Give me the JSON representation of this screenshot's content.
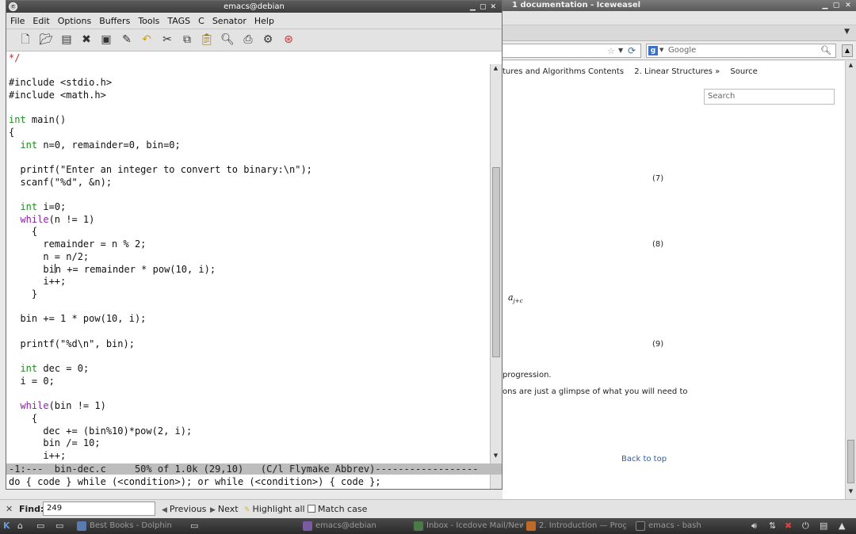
{
  "browser": {
    "title": "1 documentation - Iceweasel",
    "search_engine": "Google",
    "doc_nav": [
      "tures and Algorithms Contents",
      "2. Linear Structures »",
      "Source"
    ],
    "search_placeholder": "Search",
    "equation_numbers": [
      "(7)",
      "(8)",
      "(9)"
    ],
    "math_fragment_base": "a",
    "math_fragment_sub": "j+c",
    "text_line_1": "progression.",
    "text_line_2": "ons are just a glimpse of what you will need to",
    "back_to_top": "Back to top"
  },
  "emacs": {
    "title": "emacs@debian",
    "menu": [
      "File",
      "Edit",
      "Options",
      "Buffers",
      "Tools",
      "TAGS",
      "C",
      "Senator",
      "Help"
    ],
    "toolbar_icons": [
      "new-file-icon",
      "open-folder-icon",
      "save-icon",
      "close-icon",
      "save-as-icon",
      "edit-icon",
      "undo-icon",
      "cut-icon",
      "copy-icon",
      "paste-icon",
      "search-icon",
      "print-icon",
      "preferences-icon",
      "help-icon"
    ],
    "header_line": "*/",
    "modeline": "-1:---  bin-dec.c     50% of 1.0k (29,10)   (C/l Flymake Abbrev)------------------",
    "minibuffer": "do { code } while (<condition>); or while (<condition>) { code };"
  },
  "findbar": {
    "label": "Find:",
    "value": "249",
    "previous": "Previous",
    "next": "Next",
    "highlight_all": "Highlight all",
    "match_case": "Match case"
  },
  "taskbar": {
    "tasks": [
      {
        "label": "Best Books - Dolphin",
        "color": "#5a7bb0"
      },
      {
        "label": "emacs@debian",
        "color": "#7a5aa0"
      },
      {
        "label": "Inbox - Icedove Mail/News",
        "color": "#4a7a4a"
      },
      {
        "label": "2. Introduction — Prog",
        "color": "#c06a2a"
      },
      {
        "label": "emacs - bash",
        "color": "#333333"
      }
    ]
  }
}
